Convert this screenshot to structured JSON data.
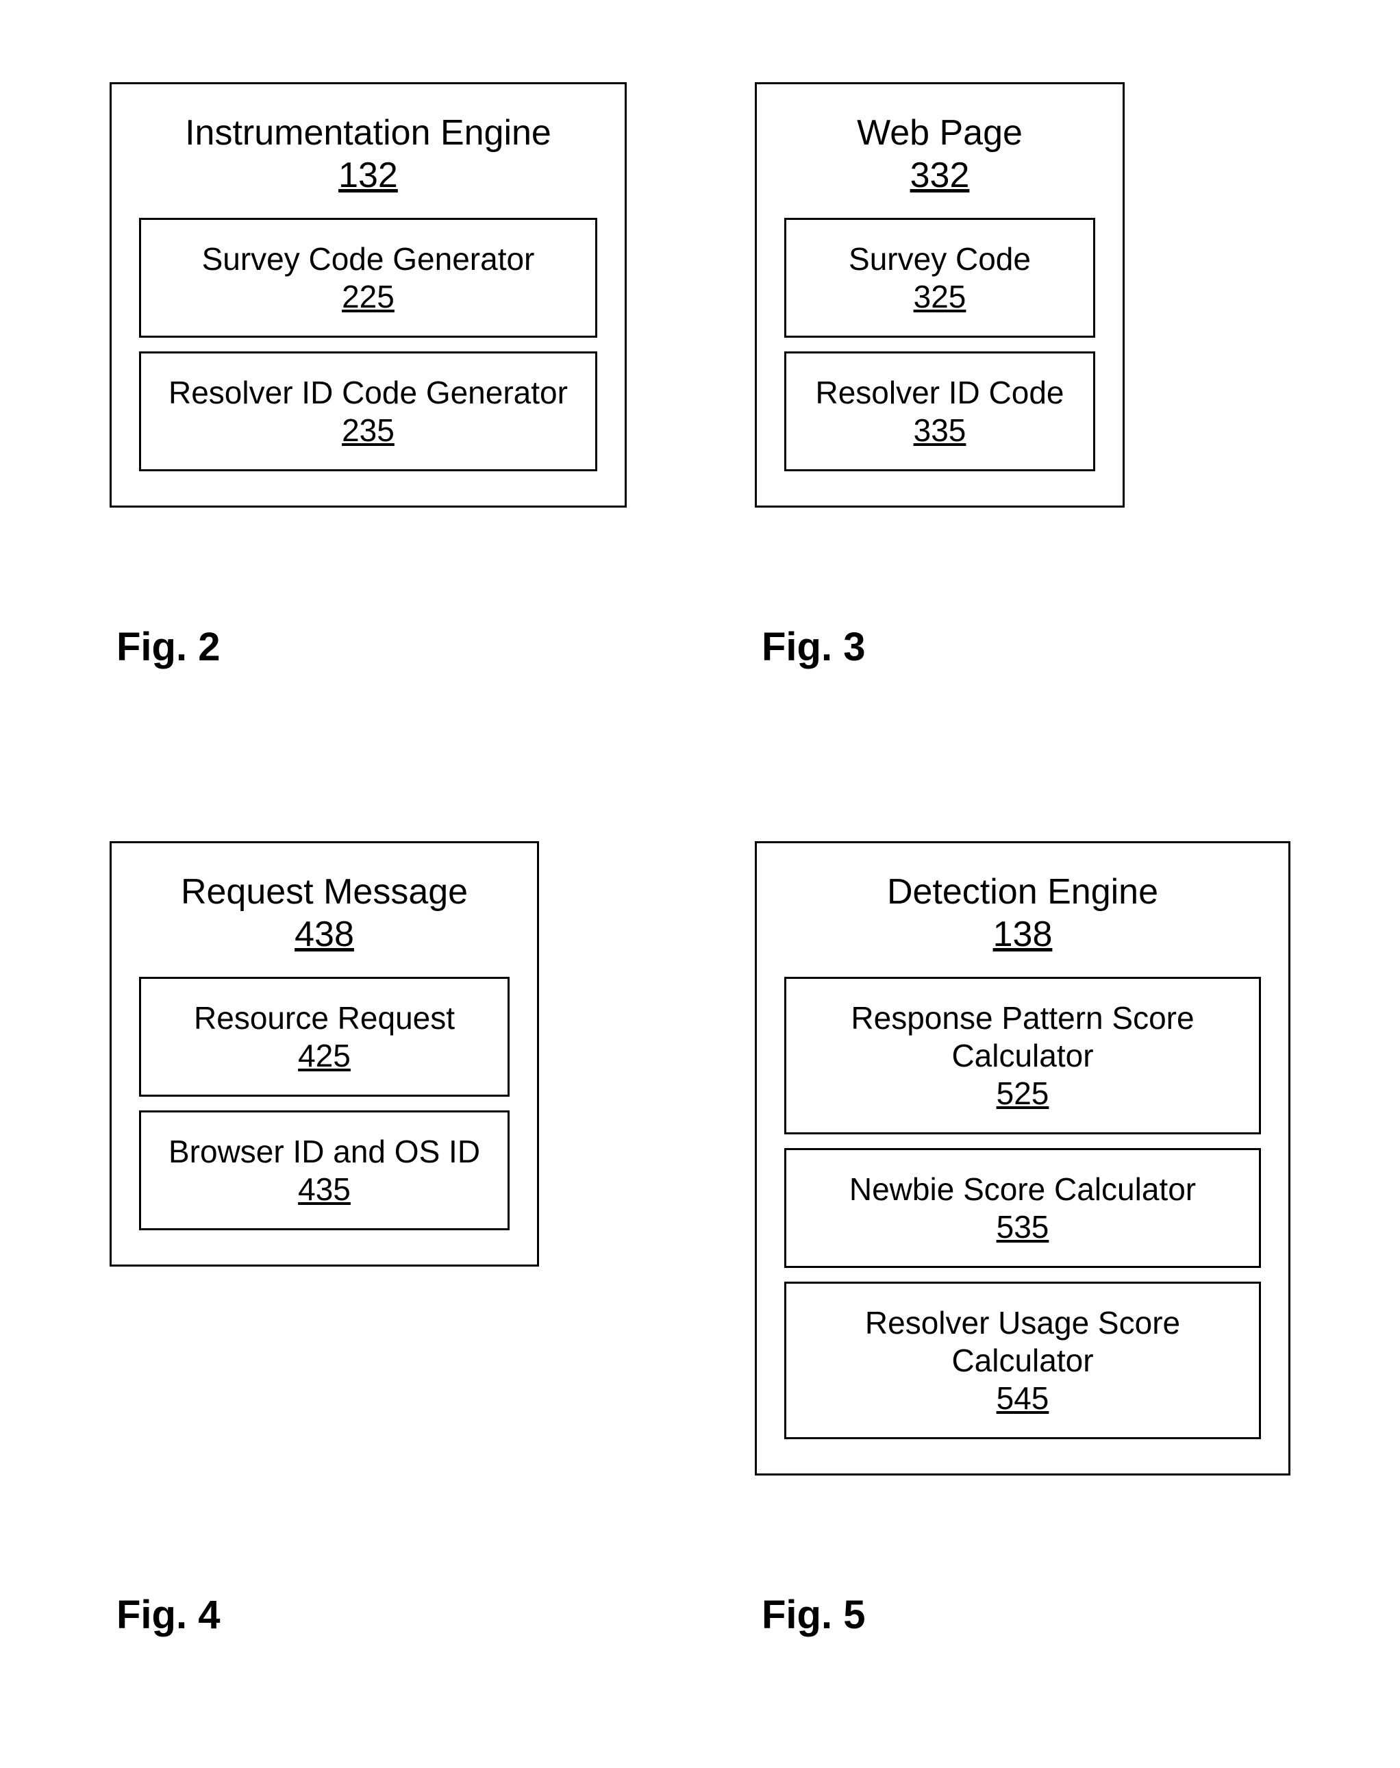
{
  "fig2": {
    "outer_title": "Instrumentation Engine",
    "outer_num": "132",
    "inner1_title": "Survey Code Generator",
    "inner1_num": "225",
    "inner2_title": "Resolver ID Code Generator",
    "inner2_num": "235",
    "fig_label": "Fig. 2"
  },
  "fig3": {
    "outer_title": "Web Page",
    "outer_num": "332",
    "inner1_title": "Survey Code",
    "inner1_num": "325",
    "inner2_title": "Resolver ID Code",
    "inner2_num": "335",
    "fig_label": "Fig. 3"
  },
  "fig4": {
    "outer_title": "Request Message",
    "outer_num": "438",
    "inner1_title": "Resource Request",
    "inner1_num": "425",
    "inner2_title": "Browser ID and OS ID",
    "inner2_num": "435",
    "fig_label": "Fig. 4"
  },
  "fig5": {
    "outer_title": "Detection Engine",
    "outer_num": "138",
    "inner1_title": "Response Pattern Score Calculator",
    "inner1_num": "525",
    "inner2_title": "Newbie Score Calculator",
    "inner2_num": "535",
    "inner3_title": "Resolver Usage Score Calculator",
    "inner3_num": "545",
    "fig_label": "Fig. 5"
  }
}
